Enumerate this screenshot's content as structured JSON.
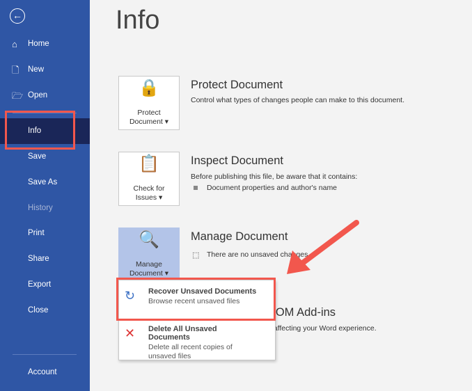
{
  "sidebar": {
    "items": [
      {
        "label": "Home",
        "icon": "home-icon"
      },
      {
        "label": "New",
        "icon": "new-file-icon"
      },
      {
        "label": "Open",
        "icon": "folder-open-icon"
      },
      {
        "label": "Info"
      },
      {
        "label": "Save"
      },
      {
        "label": "Save As"
      },
      {
        "label": "History",
        "disabled": true
      },
      {
        "label": "Print"
      },
      {
        "label": "Share"
      },
      {
        "label": "Export"
      },
      {
        "label": "Close"
      }
    ],
    "account": "Account",
    "selected": "Info"
  },
  "page_title": "Info",
  "protect": {
    "button": "Protect",
    "button2": "Document",
    "heading": "Protect Document",
    "text": "Control what types of changes people can make to this document."
  },
  "inspect": {
    "button": "Check for",
    "button2": "Issues",
    "heading": "Inspect Document",
    "text": "Before publishing this file, be aware that it contains:",
    "bullet": "Document properties and author's name"
  },
  "manage": {
    "button": "Manage",
    "button2": "Document",
    "heading": "Manage Document",
    "text": "There are no unsaved changes."
  },
  "addins": {
    "heading": "ed COM Add-ins",
    "text": "at are affecting your Word experience."
  },
  "menu": [
    {
      "title": "Recover Unsaved Documents",
      "desc": "Browse recent unsaved files"
    },
    {
      "title": "Delete All Unsaved Documents",
      "desc": "Delete all recent copies of unsaved files"
    }
  ],
  "colors": {
    "sidebar": "#2f56a5",
    "selected": "#1a2658",
    "highlight": "#f2574d"
  }
}
